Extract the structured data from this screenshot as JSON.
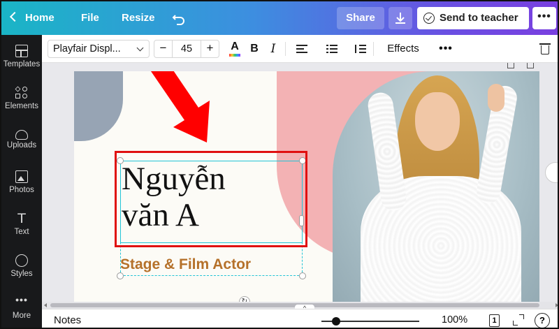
{
  "topbar": {
    "home_label": "Home",
    "file_label": "File",
    "resize_label": "Resize",
    "undo_icon": "undo-icon",
    "share_label": "Share",
    "download_icon": "download-icon",
    "send_label": "Send to teacher",
    "more_label": "•••"
  },
  "sidebar": {
    "items": [
      {
        "label": "Templates",
        "icon": "templates-icon"
      },
      {
        "label": "Elements",
        "icon": "elements-icon"
      },
      {
        "label": "Uploads",
        "icon": "uploads-icon"
      },
      {
        "label": "Photos",
        "icon": "photos-icon"
      },
      {
        "label": "Text",
        "icon": "text-icon"
      },
      {
        "label": "Styles",
        "icon": "styles-icon"
      },
      {
        "label": "More",
        "icon": "more-icon"
      }
    ]
  },
  "toolbar": {
    "font_name": "Playfair Displ...",
    "font_size": "45",
    "minus_label": "−",
    "plus_label": "+",
    "color_label": "A",
    "bold_label": "B",
    "italic_label": "I",
    "effects_label": "Effects",
    "more_label": "•••"
  },
  "design": {
    "title_line1": "Nguyễn",
    "title_line2": "văn A",
    "subtitle": "Stage & Film Actor",
    "subtitle_color": "#b5712a",
    "selection_color": "#22c4d6",
    "highlight_color": "#e01010"
  },
  "bottombar": {
    "notes_label": "Notes",
    "zoom_value": "100%",
    "zoom_fraction": 0.15,
    "page_count": "1",
    "help_label": "?"
  },
  "colors": {
    "topbar_gradient_start": "#1ab5c6",
    "topbar_gradient_end": "#7a3fe0",
    "sidebar_bg": "#18191b"
  }
}
